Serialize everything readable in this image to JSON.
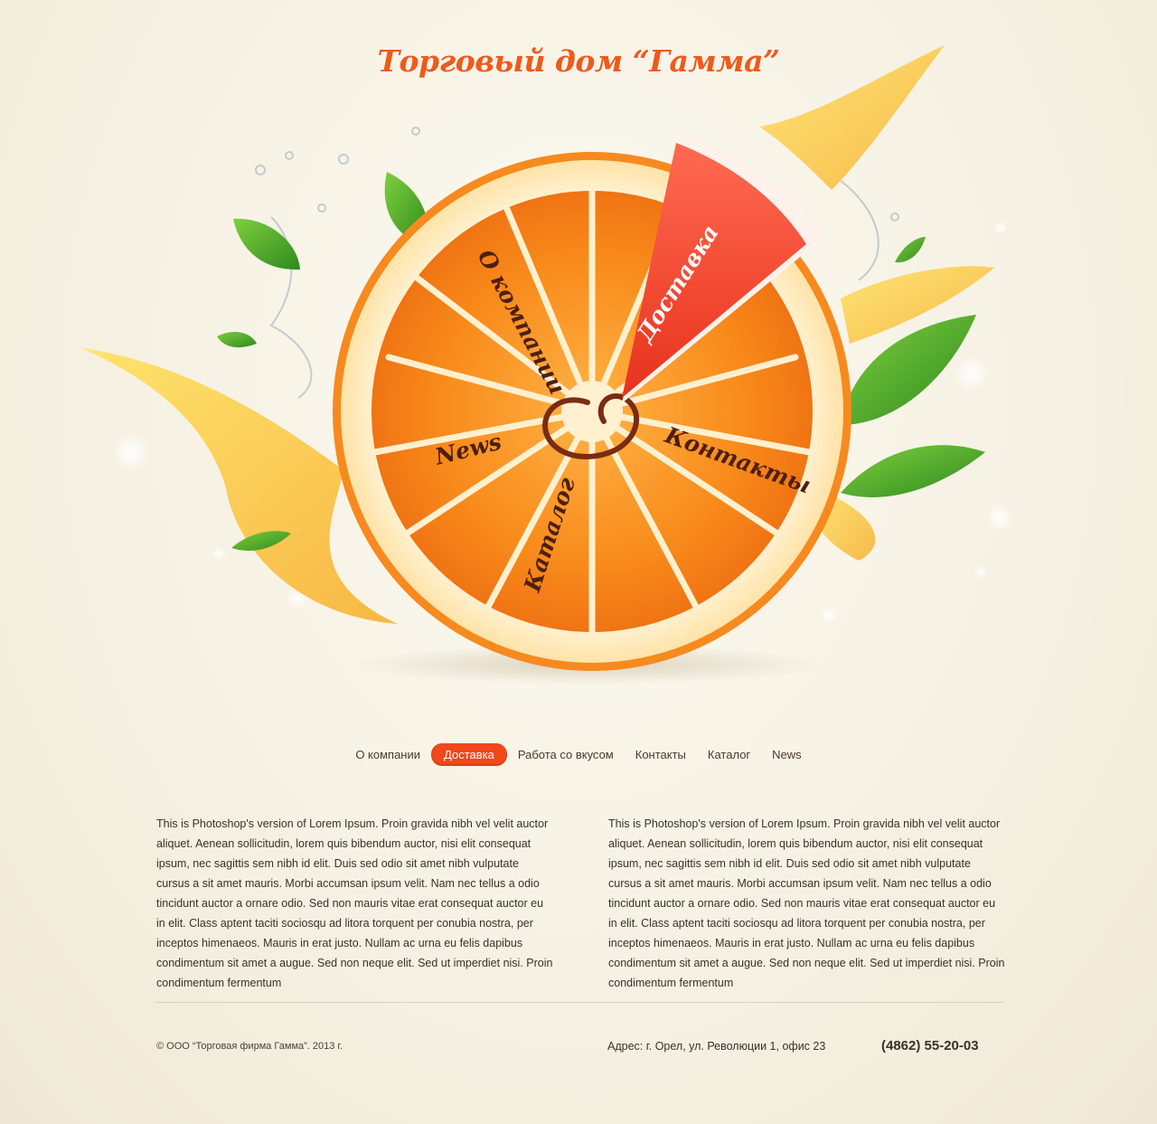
{
  "header": {
    "title": "Торговый дом “Гамма”"
  },
  "wheel": {
    "labels": {
      "about": "О компании",
      "delivery": "Доставка",
      "contacts": "Контакты",
      "catalog": "Каталог",
      "news": "News"
    }
  },
  "nav": {
    "items": [
      {
        "label": "О компании",
        "active": false
      },
      {
        "label": "Доставка",
        "active": true
      },
      {
        "label": "Работа со вкусом",
        "active": false
      },
      {
        "label": "Контакты",
        "active": false
      },
      {
        "label": "Каталог",
        "active": false
      },
      {
        "label": "News",
        "active": false
      }
    ]
  },
  "content": {
    "left": "This is Photoshop's version  of Lorem Ipsum. Proin gravida nibh vel velit auctor aliquet. Aenean sollicitudin, lorem quis bibendum auctor, nisi elit consequat ipsum, nec sagittis sem nibh id elit. Duis sed odio sit amet nibh vulputate cursus a sit amet mauris. Morbi accumsan ipsum velit. Nam nec tellus a odio tincidunt auctor a ornare odio. Sed non  mauris vitae erat consequat auctor eu in elit. Class aptent taciti sociosqu ad litora torquent per conubia nostra, per inceptos himenaeos. Mauris in erat justo. Nullam ac urna eu felis dapibus condimentum sit amet a augue. Sed non neque elit. Sed ut imperdiet nisi. Proin condimentum fermentum",
    "right": "This is Photoshop's version  of Lorem Ipsum. Proin gravida nibh vel velit auctor aliquet. Aenean sollicitudin, lorem quis bibendum auctor, nisi elit consequat ipsum, nec sagittis sem nibh id elit. Duis sed odio sit amet nibh vulputate cursus a sit amet mauris. Morbi accumsan ipsum velit. Nam nec tellus a odio tincidunt auctor a ornare odio. Sed non  mauris vitae erat consequat auctor eu in elit. Class aptent taciti sociosqu ad litora torquent per conubia nostra, per inceptos himenaeos. Mauris in erat justo. Nullam ac urna eu felis dapibus condimentum sit amet a augue. Sed non neque elit. Sed ut imperdiet nisi. Proin condimentum fermentum"
  },
  "footer": {
    "copyright": "© ООО “Торговая фирма Гамма”. 2013 г.",
    "address": "Адрес: г. Орел, ул. Революции 1, офис 23",
    "phone": "(4862) 55-20-03"
  },
  "colors": {
    "accent": "#f0481a",
    "title": "#ee5a1c",
    "orange": "#f7931e",
    "text": "#3a3128"
  }
}
